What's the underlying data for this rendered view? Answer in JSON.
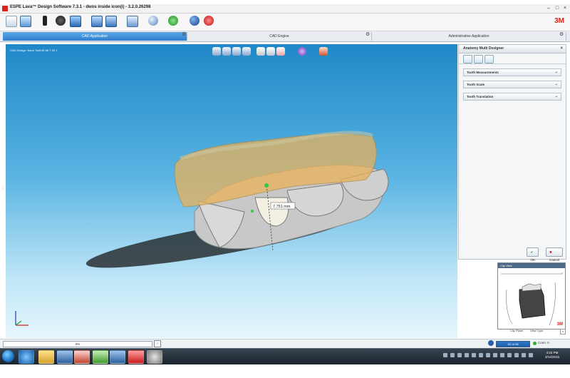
{
  "window": {
    "title": "ESPE Lava™ Design Software 7.3.1 - dwos inside icon(i) - 3.2.0.26298",
    "minimize": "–",
    "maximize": "□",
    "close": "×",
    "brand": "3M"
  },
  "workflow_tabs": [
    {
      "label": "CAD Application",
      "active": true
    },
    {
      "label": "CAD Engine",
      "active": false
    },
    {
      "label": "Administrative Application",
      "active": false
    }
  ],
  "viewport": {
    "status": "CAD Design: None    ToothID #8 T 03 1",
    "measurement": "7.751 mm"
  },
  "panel": {
    "title": "Anatomy Multi Designer",
    "close": "×",
    "sections": [
      {
        "label": "Tooth Measurements"
      },
      {
        "label": "Tooth Scale"
      },
      {
        "label": "Tooth Translation"
      }
    ],
    "ok_label": "OK",
    "cancel_label": "Cancel",
    "ok_glyph": "✔",
    "cancel_glyph": "✖"
  },
  "clip_window": {
    "title": "Clip View",
    "brand": "3M",
    "labels": [
      "Clip Plane",
      "View Type"
    ],
    "close": "x"
  },
  "statusbar": {
    "progress_text": "0%",
    "progress_fraction": 0,
    "memory_text": "3G of 85",
    "connection_text": "Conn: 0"
  },
  "taskbar": {
    "time": "4:22 PM",
    "date": "3/14/2016"
  },
  "colors": {
    "accent": "#2f7fd0",
    "brand_red": "#d8261d",
    "viewport_top": "#1f88c8",
    "viewport_bottom": "#e5f6fc"
  },
  "icons": {
    "toolbar": [
      "edit-icon",
      "open-icon",
      "scanner-icon",
      "disc-icon",
      "monitor-icon",
      "monitor-alt-icon",
      "monitor-settings-icon",
      "screen-icon",
      "link-icon",
      "refresh-icon",
      "info-icon",
      "stop-icon"
    ],
    "viewport_tools": [
      "cube-front-icon",
      "cube-left-icon",
      "cube-right-icon",
      "cube-half-icon",
      "tool-knife-icon",
      "tool-hand-icon",
      "tooth-red-icon",
      "target-icon",
      "camera-icon"
    ],
    "panel_tabs": [
      "anatomy-tab-icon",
      "morph-tab-icon",
      "freeform-tab-icon"
    ]
  }
}
